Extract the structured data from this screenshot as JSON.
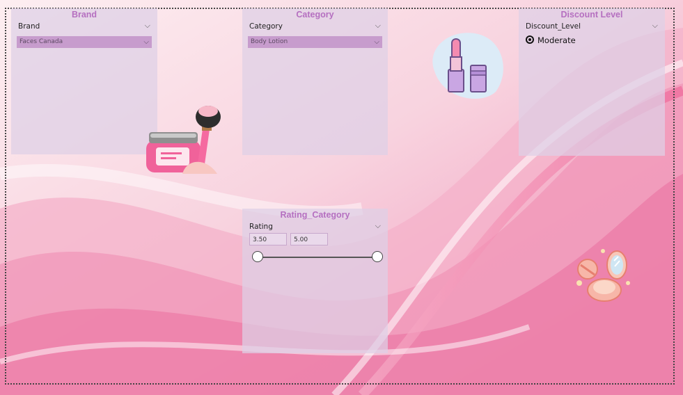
{
  "slicers": {
    "brand": {
      "title": "Brand",
      "field": "Brand",
      "selected": "Faces Canada"
    },
    "category": {
      "title": "Category",
      "field": "Category",
      "selected": "Body Lotion"
    },
    "discount": {
      "title": "Discount Level",
      "field": "Discount_Level",
      "option": "Moderate"
    },
    "rating": {
      "title": "Rating_Category",
      "field": "Rating",
      "min_value": "3.50",
      "max_value": "5.00"
    }
  },
  "colors": {
    "accent": "#b56fc0",
    "dropdown": "#c79ccd",
    "panel": "#ded0e6"
  },
  "icons": [
    "chevron-down-icon",
    "makeup-jar-icon",
    "lipstick-icon",
    "compact-mirror-icon"
  ]
}
